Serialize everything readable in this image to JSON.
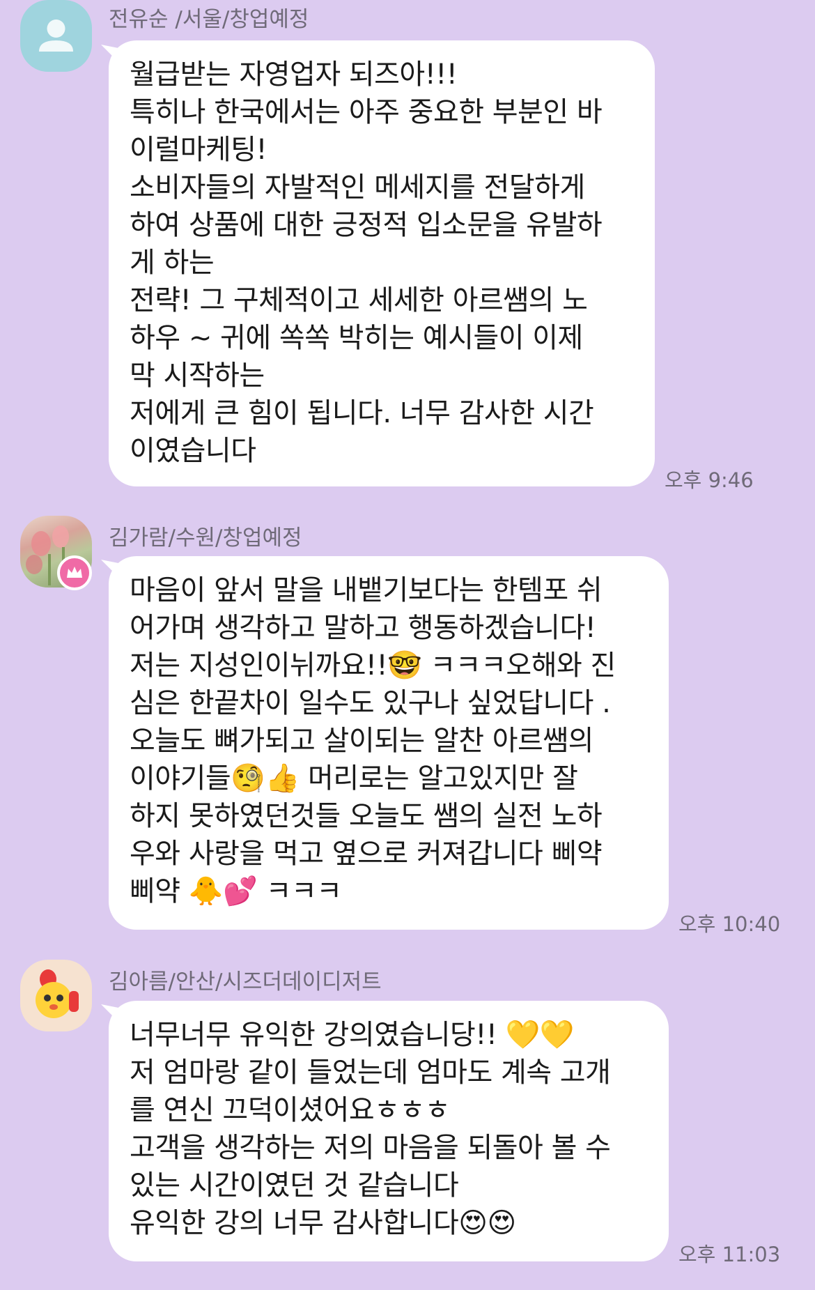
{
  "messages": [
    {
      "sender": "전유순 /서울/창업예정",
      "time": "오후 9:46",
      "lines": [
        "월급받는 자영업자 되즈아!!!",
        "특히나 한국에서는 아주 중요한 부분인 바",
        "이럴마케팅!",
        "소비자들의 자발적인 메세지를 전달하게",
        "하여 상품에 대한 긍정적 입소문을 유발하",
        "게 하는",
        "전략!  그 구체적이고 세세한 아르쌤의  노",
        "하우 ~ 귀에 쏙쏙 박히는 예시들이  이제",
        "막 시작하는",
        "저에게 큰 힘이 됩니다. 너무 감사한 시간",
        "이였습니다"
      ]
    },
    {
      "sender": "김가람/수원/창업예정",
      "time": "오후 10:40",
      "lines": [
        "마음이 앞서 말을 내뱉기보다는 한템포 쉬",
        "어가며 생각하고 말하고 행동하겠습니다!",
        "저는 지성인이뉘까요!!🤓 ㅋㅋㅋ오해와 진",
        "심은 한끝차이 일수도 있구나 싶었답니다 .",
        "오늘도 뼈가되고 살이되는 알찬 아르쌤의",
        "이야기들🧐👍 머리로는 알고있지만 잘",
        "하지 못하였던것들 오늘도 쌤의 실전 노하",
        "우와 사랑을 먹고 옆으로 커져갑니다 삐약",
        "삐약 🐥💕 ㅋㅋㅋ"
      ]
    },
    {
      "sender": "김아름/안산/시즈더데이디저트",
      "time": "오후 11:03",
      "lines": [
        "너무너무 유익한 강의였습니당!! 💛💛",
        "저 엄마랑 같이 들었는데 엄마도 계속 고개",
        "를 연신 끄덕이셨어요ㅎㅎㅎ",
        "고객을 생각하는 저의 마음을 되돌아 볼 수",
        "있는 시간이였던 것 같습니다",
        "유익한 강의 너무 감사합니다😍😍"
      ]
    }
  ],
  "icons": {
    "avatar1": "person-silhouette-icon",
    "avatar2": "flower-photo",
    "avatar2_badge": "crown-icon",
    "avatar3": "cartoon-character"
  },
  "colors": {
    "background": "#dccbf0",
    "bubble": "#ffffff",
    "meta_text": "#6f6a78",
    "badge": "#f06aa6"
  }
}
